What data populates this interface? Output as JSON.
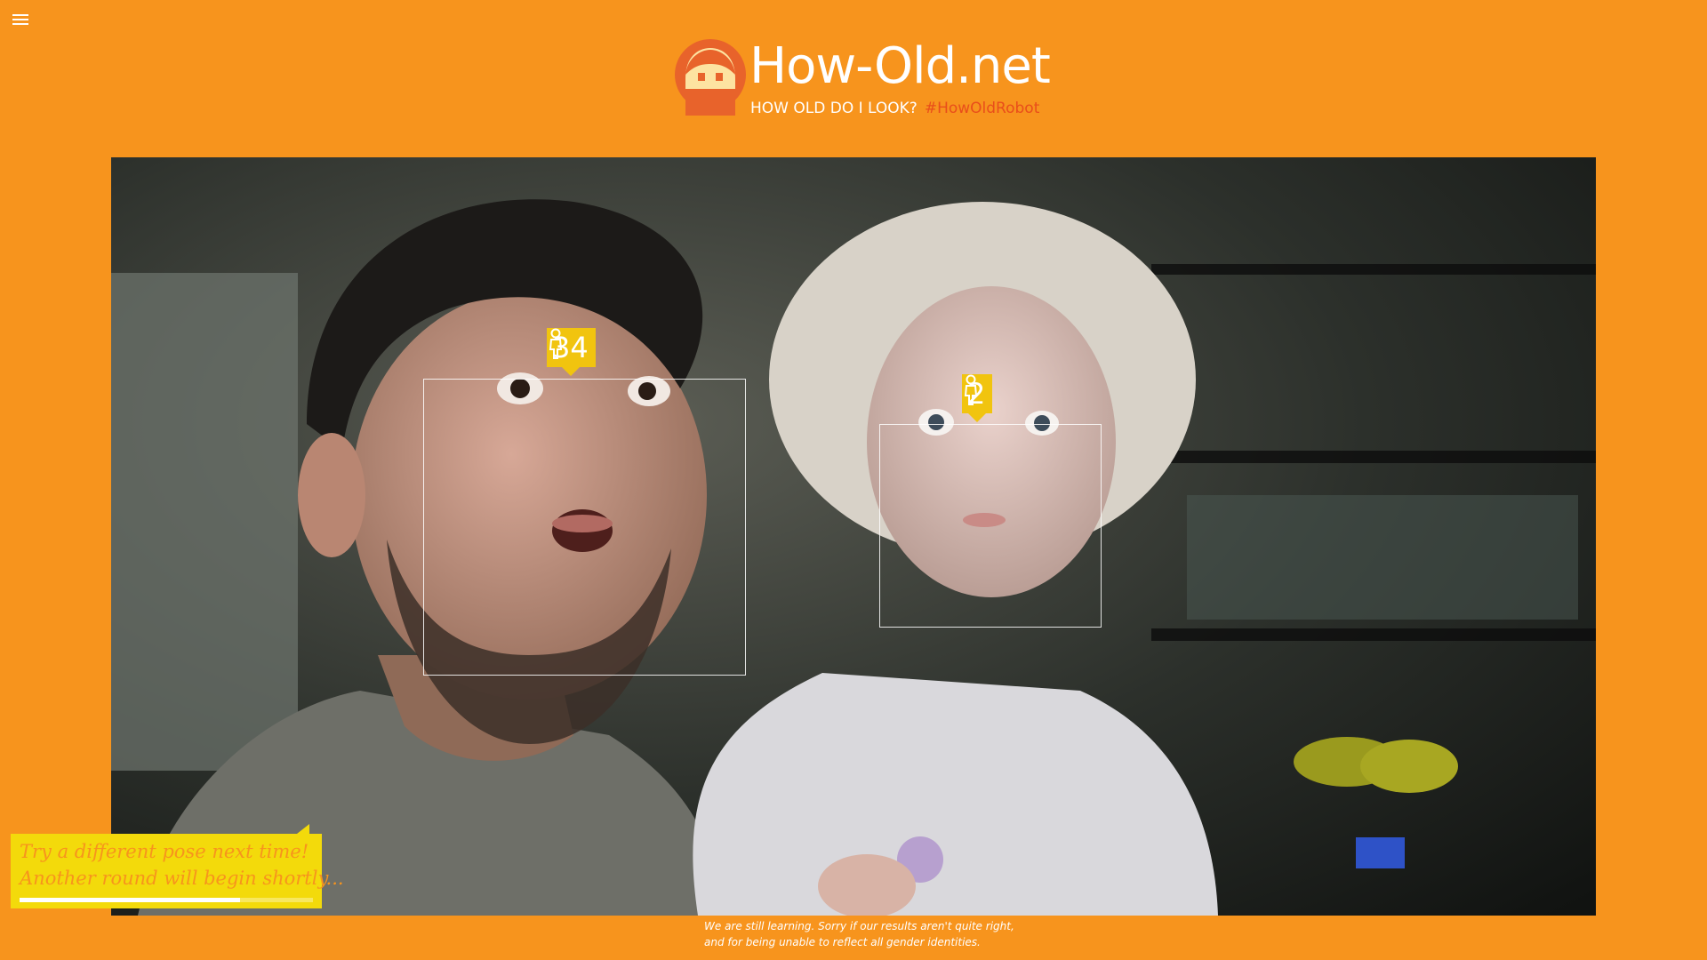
{
  "header": {
    "title": "How-Old.net",
    "tagline_question": "HOW OLD DO I LOOK?",
    "tagline_hashtag": "#HowOldRobot",
    "logo_icon": "robot-face-logo-icon"
  },
  "menu": {
    "icon": "hamburger-menu-icon"
  },
  "faces": [
    {
      "age": "34",
      "gender_icon": "person-icon"
    },
    {
      "age": "2",
      "gender_icon": "person-icon"
    }
  ],
  "notification": {
    "line1": "Try a different pose next time!",
    "line2": "Another round will begin shortly...",
    "progress": 0.75
  },
  "footer": {
    "line1": "We are still learning. Sorry if our results aren't quite right,",
    "line2": "and for being unable to reflect all gender identities."
  },
  "colors": {
    "background": "#f7941d",
    "tag": "#f1c40f",
    "notification": "#f3da0b",
    "hashtag": "#e94e1b"
  }
}
